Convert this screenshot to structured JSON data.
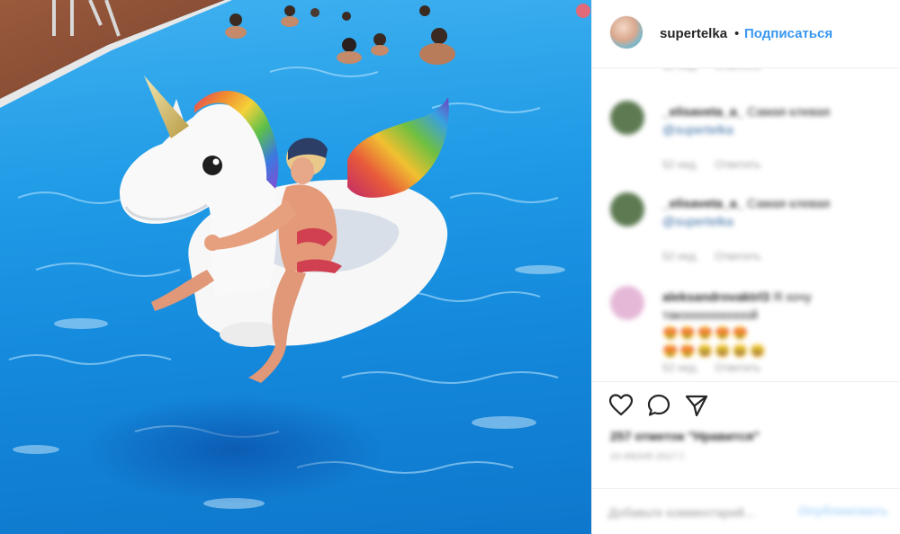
{
  "header": {
    "username": "supertelka",
    "separator": "•",
    "follow_label": "Подписаться"
  },
  "comments": [
    {
      "user": "_elisaveta_a_",
      "text": "Самая клевая",
      "mention": "@supertelka",
      "time": "52 нед.",
      "reply": "Ответить",
      "avatar_color": "#5d7a52"
    },
    {
      "user": "_elisaveta_a_",
      "text": "Самая клевая",
      "mention": "@supertelka",
      "time": "52 нед.",
      "reply": "Ответить",
      "avatar_color": "#5d7a52"
    },
    {
      "user": "aleksandrovaktrl3",
      "text": "Я хочу такоооооооооой",
      "emoji_line_1": "😍😍😍😍😍",
      "emoji_line_2": "😍😍😆😆😆😆",
      "time": "52 нед.",
      "reply": "Ответить",
      "avatar_color": "#e6b8d8"
    }
  ],
  "actions": {
    "likes_text": "257 отметок \"Нравится\"",
    "timestamp": "24 ИЮНЯ 2017 Г.",
    "like_icon": "heart-icon",
    "comment_icon": "comment-bubble-icon",
    "share_icon": "share-arrow-icon"
  },
  "comment_box": {
    "placeholder": "Добавьте комментарий...",
    "publish_label": "Опубликовать"
  },
  "colors": {
    "accent": "#3897f0",
    "pool": "#1f9ae6",
    "text": "#262626",
    "muted": "#999999"
  }
}
